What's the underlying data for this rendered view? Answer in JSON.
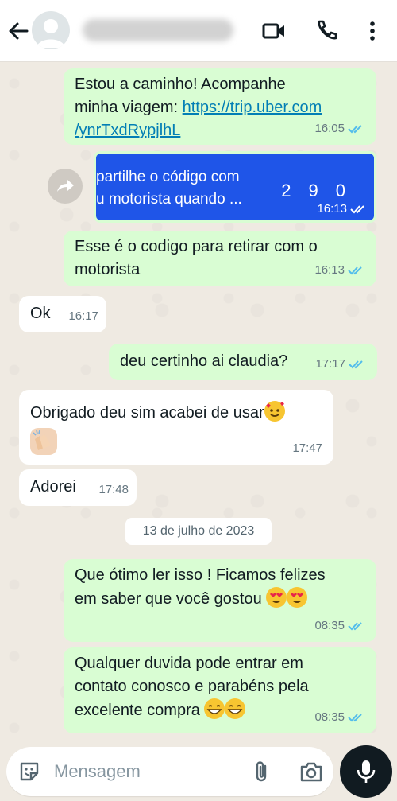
{
  "header": {
    "contact_name": "████ ██ ████ ████",
    "icons": [
      "back-arrow-icon",
      "avatar-icon",
      "video-call-icon",
      "phone-icon",
      "more-options-icon"
    ]
  },
  "messages": [
    {
      "dir": "out",
      "text_lines": [
        "Estou a caminho! Acompanhe",
        "minha viagem: "
      ],
      "link": "https://trip.uber.com",
      "link2": "/ynrTxdRypjlhL",
      "time": "16:05"
    },
    {
      "dir": "out",
      "type": "image",
      "line1": "partilhe o código com",
      "line2": "u motorista quando ...",
      "code": "290",
      "time": "16:13"
    },
    {
      "dir": "out",
      "line1": "Esse é o codigo para retirar com o",
      "line2": "motorista",
      "time": "16:13"
    },
    {
      "dir": "in",
      "text": "Ok",
      "time": "16:17"
    },
    {
      "dir": "out",
      "text": "deu certinho ai claudia?",
      "time": "17:17"
    },
    {
      "dir": "in",
      "text": "Obrigado deu sim acabei de usar",
      "time": "17:47"
    },
    {
      "dir": "in",
      "text": "Adorei",
      "time": "17:48"
    },
    {
      "dir": "out",
      "line1": "Que ótimo ler isso ! Ficamos felizes",
      "line2": "em saber que você gostou",
      "time": "08:35"
    },
    {
      "dir": "out",
      "line1": "Qualquer duvida pode entrar em",
      "line2": "contato conosco e parabéns pela",
      "line3": "excelente compra",
      "time": "08:35"
    }
  ],
  "date_separator": "13 de julho de 2023",
  "composer": {
    "placeholder": "Mensagem",
    "icons": [
      "sticker-icon",
      "attach-icon",
      "camera-icon",
      "mic-icon"
    ]
  },
  "colors": {
    "outgoing": "#d9fdd3",
    "incoming": "#ffffff",
    "read_ticks": "#53bdeb",
    "background": "#efeae2"
  }
}
